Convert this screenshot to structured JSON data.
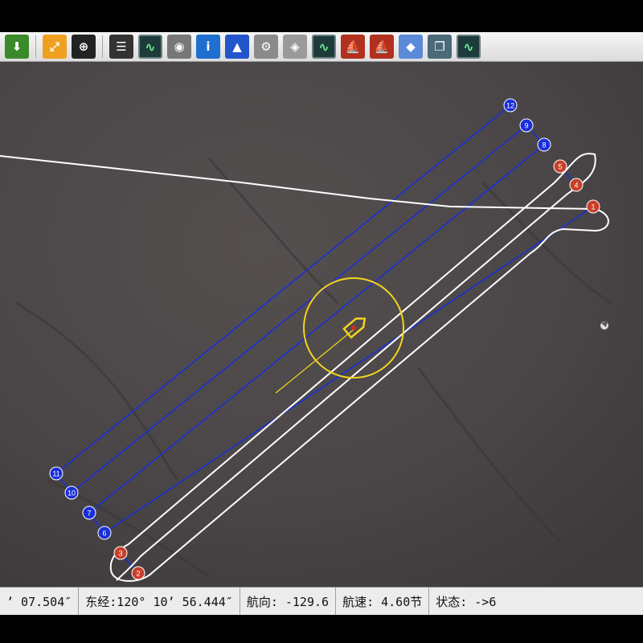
{
  "toolbar": {
    "buttons": [
      {
        "name": "download-icon",
        "glyph": "⬇",
        "color": "#3a8a2a"
      },
      {
        "name": "expand-icon",
        "glyph": "⤢",
        "color": "#f0a020"
      },
      {
        "name": "crosshair-icon",
        "glyph": "⊕",
        "color": "#222222"
      },
      {
        "name": "list-icon",
        "glyph": "☰",
        "color": "#333333"
      },
      {
        "name": "monitor-icon",
        "glyph": "∿",
        "color": "#1d3b3b"
      },
      {
        "name": "webcam-icon",
        "glyph": "◉",
        "color": "#777777"
      },
      {
        "name": "info-icon",
        "glyph": "i",
        "color": "#1e6fd0"
      },
      {
        "name": "navigation-arrow-icon",
        "glyph": "▲",
        "color": "#2255cc"
      },
      {
        "name": "gear-icon",
        "glyph": "⚙",
        "color": "#8a8a8a"
      },
      {
        "name": "route-icon",
        "glyph": "◈",
        "color": "#9a9a9a"
      },
      {
        "name": "monitor-icon",
        "glyph": "∿",
        "color": "#1d3b3b"
      },
      {
        "name": "boat-icon",
        "glyph": "⛵",
        "color": "#b23020"
      },
      {
        "name": "boat-icon",
        "glyph": "⛵",
        "color": "#b23020"
      },
      {
        "name": "group-icon",
        "glyph": "◆",
        "color": "#5a8ad8"
      },
      {
        "name": "window-icon",
        "glyph": "❐",
        "color": "#4a6a7a"
      },
      {
        "name": "monitor-icon",
        "glyph": "∿",
        "color": "#1d3b3b"
      }
    ]
  },
  "waypoints_blue": [
    {
      "label": "12"
    },
    {
      "label": "9"
    },
    {
      "label": "8"
    },
    {
      "label": "11"
    },
    {
      "label": "10"
    },
    {
      "label": "7"
    },
    {
      "label": "6"
    }
  ],
  "waypoints_red": [
    {
      "label": "5"
    },
    {
      "label": "4"
    },
    {
      "label": "1"
    },
    {
      "label": "3"
    },
    {
      "label": "2"
    }
  ],
  "status": {
    "lat": "’ 07.504″",
    "lon": "东经:120° 10’ 56.444″",
    "heading": "航向: -129.6",
    "speed": "航速: 4.60节",
    "state": "状态: ->6"
  },
  "colors": {
    "map_bg": "#4b4649",
    "route_blue": "#1a2fd8",
    "track_white": "#ffffff",
    "marker_red": "#c8402a",
    "boat_yellow": "#f2d51b"
  }
}
